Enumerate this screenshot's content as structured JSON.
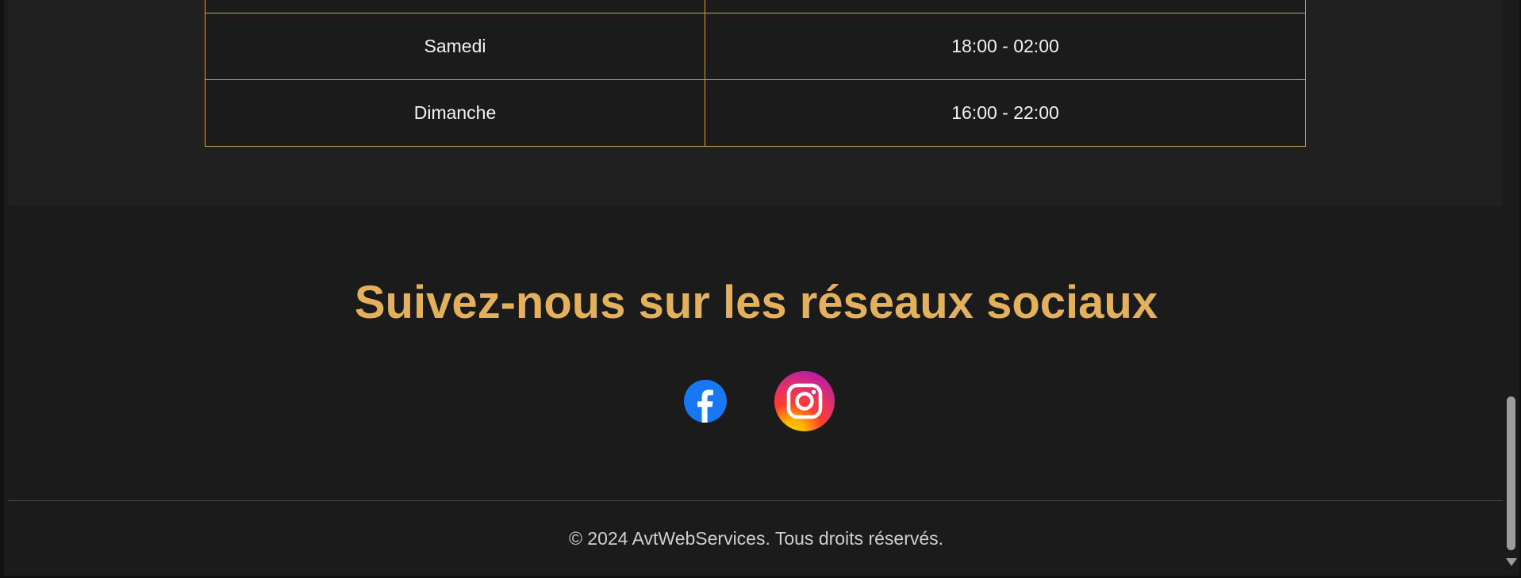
{
  "hours": {
    "rows": [
      {
        "day": "",
        "time": ""
      },
      {
        "day": "Samedi",
        "time": "18:00 - 02:00"
      },
      {
        "day": "Dimanche",
        "time": "16:00 - 22:00"
      }
    ]
  },
  "social": {
    "title": "Suivez-nous sur les réseaux sociaux",
    "links": [
      {
        "icon": "facebook-icon",
        "color": "#1877f2"
      },
      {
        "icon": "instagram-icon",
        "color": "#e1306c"
      }
    ]
  },
  "footer": {
    "copyright": "© 2024 AvtWebServices. Tous droits réservés."
  },
  "colors": {
    "accent": "#e3b15d",
    "table_border": "#c8a15e",
    "background": "#1b1b1b",
    "section_background": "#202020"
  }
}
